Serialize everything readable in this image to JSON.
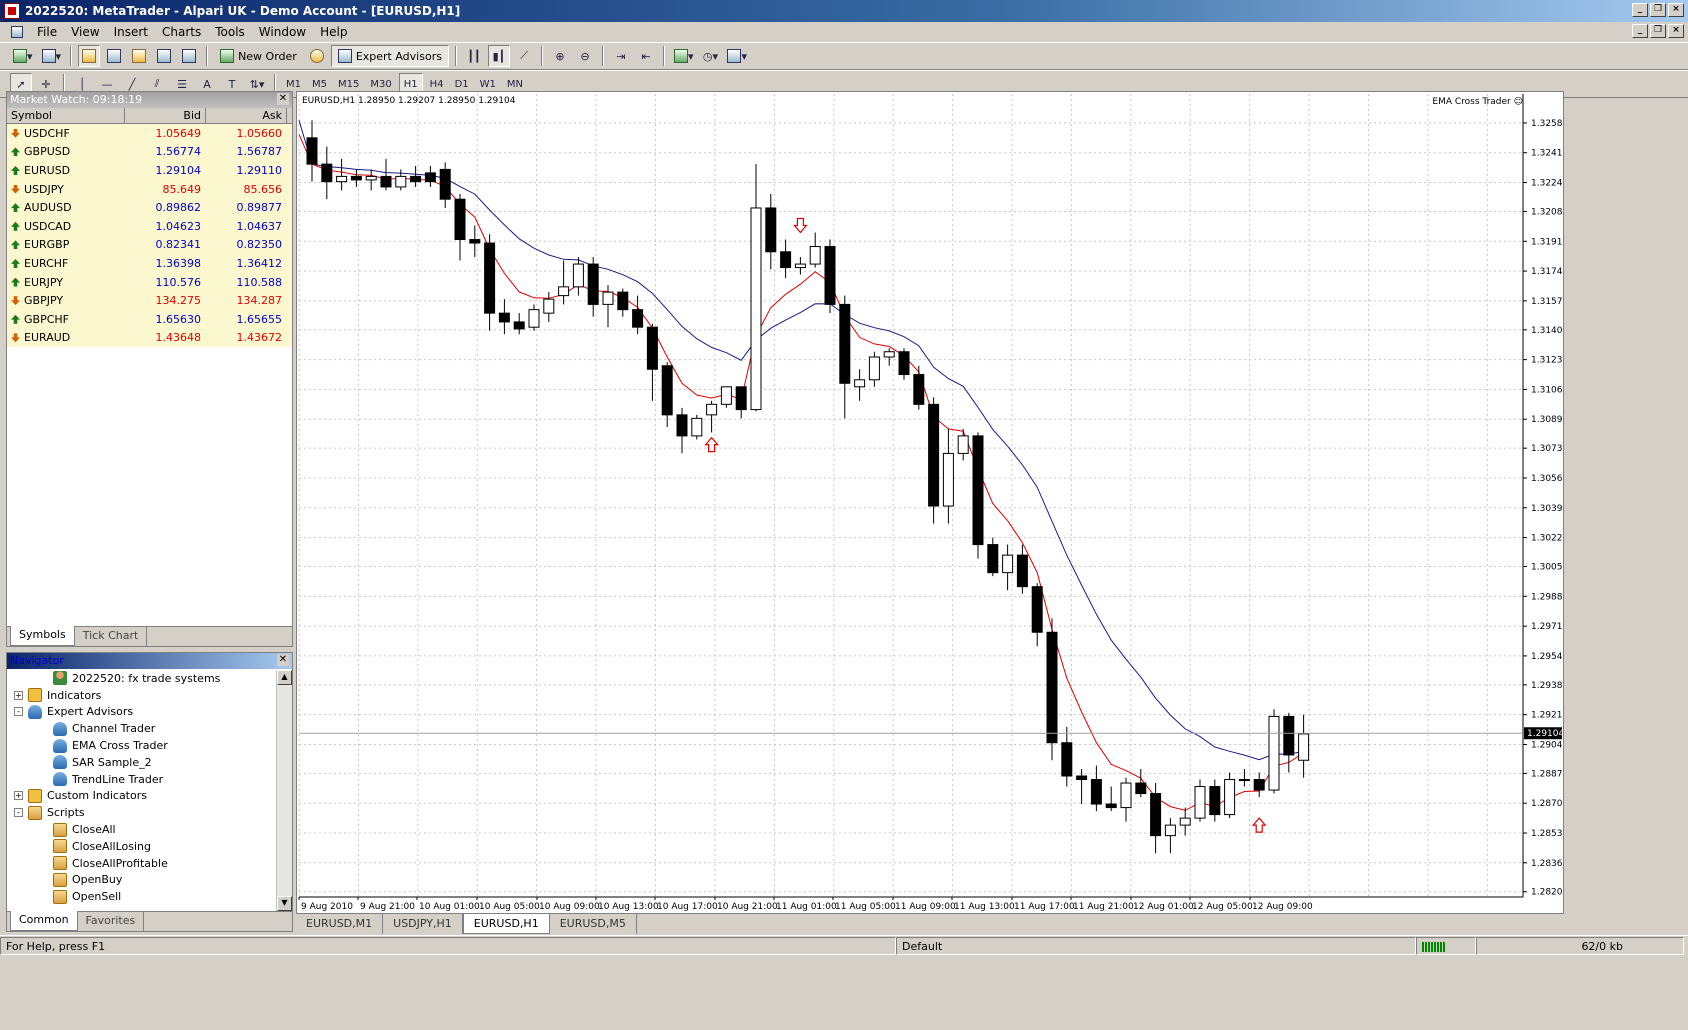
{
  "window": {
    "title": "2022520: MetaTrader - Alpari UK - Demo Account - [EURUSD,H1]"
  },
  "menu": [
    "File",
    "View",
    "Insert",
    "Charts",
    "Tools",
    "Window",
    "Help"
  ],
  "toolbar": {
    "new_order": "New Order",
    "expert_advisors": "Expert Advisors",
    "timeframes": [
      "M1",
      "M5",
      "M15",
      "M30",
      "H1",
      "H4",
      "D1",
      "W1",
      "MN"
    ],
    "active_timeframe": "H1"
  },
  "market_watch": {
    "title": "Market Watch: 09:18:19",
    "columns": [
      "Symbol",
      "Bid",
      "Ask"
    ],
    "rows": [
      {
        "symbol": "USDCHF",
        "bid": "1.05649",
        "ask": "1.05660",
        "dir": "down"
      },
      {
        "symbol": "GBPUSD",
        "bid": "1.56774",
        "ask": "1.56787",
        "dir": "up"
      },
      {
        "symbol": "EURUSD",
        "bid": "1.29104",
        "ask": "1.29110",
        "dir": "up"
      },
      {
        "symbol": "USDJPY",
        "bid": "85.649",
        "ask": "85.656",
        "dir": "down"
      },
      {
        "symbol": "AUDUSD",
        "bid": "0.89862",
        "ask": "0.89877",
        "dir": "up"
      },
      {
        "symbol": "USDCAD",
        "bid": "1.04623",
        "ask": "1.04637",
        "dir": "up"
      },
      {
        "symbol": "EURGBP",
        "bid": "0.82341",
        "ask": "0.82350",
        "dir": "up"
      },
      {
        "symbol": "EURCHF",
        "bid": "1.36398",
        "ask": "1.36412",
        "dir": "up"
      },
      {
        "symbol": "EURJPY",
        "bid": "110.576",
        "ask": "110.588",
        "dir": "up"
      },
      {
        "symbol": "GBPJPY",
        "bid": "134.275",
        "ask": "134.287",
        "dir": "down"
      },
      {
        "symbol": "GBPCHF",
        "bid": "1.65630",
        "ask": "1.65655",
        "dir": "up"
      },
      {
        "symbol": "EURAUD",
        "bid": "1.43648",
        "ask": "1.43672",
        "dir": "down"
      }
    ],
    "tabs": [
      "Symbols",
      "Tick Chart"
    ]
  },
  "navigator": {
    "title": "Navigator",
    "items": [
      {
        "label": "2022520: fx trade systems",
        "icon": "account-icon",
        "level": 2,
        "exp": ""
      },
      {
        "label": "Indicators",
        "icon": "indicators-icon",
        "level": 1,
        "exp": "+"
      },
      {
        "label": "Expert Advisors",
        "icon": "expert-icon",
        "level": 1,
        "exp": "-"
      },
      {
        "label": "Channel Trader",
        "icon": "expert-icon",
        "level": 2,
        "exp": ""
      },
      {
        "label": "EMA Cross Trader",
        "icon": "expert-icon",
        "level": 2,
        "exp": ""
      },
      {
        "label": "SAR Sample_2",
        "icon": "expert-icon",
        "level": 2,
        "exp": ""
      },
      {
        "label": "TrendLine Trader",
        "icon": "expert-icon",
        "level": 2,
        "exp": ""
      },
      {
        "label": "Custom Indicators",
        "icon": "indicators-icon",
        "level": 1,
        "exp": "+"
      },
      {
        "label": "Scripts",
        "icon": "script-icon",
        "level": 1,
        "exp": "-"
      },
      {
        "label": "CloseAll",
        "icon": "script-icon",
        "level": 2,
        "exp": ""
      },
      {
        "label": "CloseAllLosing",
        "icon": "script-icon",
        "level": 2,
        "exp": ""
      },
      {
        "label": "CloseAllProfitable",
        "icon": "script-icon",
        "level": 2,
        "exp": ""
      },
      {
        "label": "OpenBuy",
        "icon": "script-icon",
        "level": 2,
        "exp": ""
      },
      {
        "label": "OpenSell",
        "icon": "script-icon",
        "level": 2,
        "exp": ""
      }
    ],
    "tabs": [
      "Common",
      "Favorites"
    ]
  },
  "chart": {
    "info": "EURUSD,H1  1.28950 1.29207 1.28950 1.29104",
    "expert_label": "EMA Cross Trader",
    "tabs": [
      "EURUSD,M1",
      "USDJPY,H1",
      "EURUSD,H1",
      "EURUSD,M5"
    ],
    "active_tab": "EURUSD,H1"
  },
  "chart_data": {
    "type": "candlestick",
    "symbol": "EURUSD",
    "timeframe": "H1",
    "current_price": "1.29104",
    "y_ticks": [
      "1.32585",
      "1.32415",
      "1.32245",
      "1.32080",
      "1.31910",
      "1.31740",
      "1.31570",
      "1.31405",
      "1.31235",
      "1.31065",
      "1.30895",
      "1.30730",
      "1.30560",
      "1.30390",
      "1.30220",
      "1.30055",
      "1.29885",
      "1.29715",
      "1.29545",
      "1.29380",
      "1.29210",
      "1.29040",
      "1.28875",
      "1.28705",
      "1.28535",
      "1.28365",
      "1.28200"
    ],
    "x_ticks": [
      "9 Aug 2010",
      "9 Aug 21:00",
      "10 Aug 01:00",
      "10 Aug 05:00",
      "10 Aug 09:00",
      "10 Aug 13:00",
      "10 Aug 17:00",
      "10 Aug 21:00",
      "11 Aug 01:00",
      "11 Aug 05:00",
      "11 Aug 09:00",
      "11 Aug 13:00",
      "11 Aug 17:00",
      "11 Aug 21:00",
      "12 Aug 01:00",
      "12 Aug 05:00",
      "12 Aug 09:00"
    ],
    "ylim": [
      1.2817,
      1.3275
    ],
    "candles": [
      [
        1.325,
        1.326,
        1.3225,
        1.3235
      ],
      [
        1.3235,
        1.3245,
        1.3215,
        1.3225
      ],
      [
        1.3225,
        1.3238,
        1.322,
        1.3228
      ],
      [
        1.3228,
        1.3232,
        1.3222,
        1.3226
      ],
      [
        1.3226,
        1.3232,
        1.322,
        1.3228
      ],
      [
        1.3228,
        1.3238,
        1.322,
        1.3222
      ],
      [
        1.3222,
        1.3232,
        1.322,
        1.3228
      ],
      [
        1.3228,
        1.3234,
        1.3222,
        1.3225
      ],
      [
        1.323,
        1.3234,
        1.3222,
        1.3225
      ],
      [
        1.3232,
        1.3236,
        1.321,
        1.3215
      ],
      [
        1.3215,
        1.3218,
        1.318,
        1.3192
      ],
      [
        1.3192,
        1.32,
        1.3182,
        1.319
      ],
      [
        1.319,
        1.3195,
        1.314,
        1.315
      ],
      [
        1.315,
        1.3158,
        1.3138,
        1.3145
      ],
      [
        1.3145,
        1.315,
        1.3138,
        1.3141
      ],
      [
        1.3142,
        1.3155,
        1.314,
        1.3152
      ],
      [
        1.315,
        1.3162,
        1.3145,
        1.3158
      ],
      [
        1.316,
        1.318,
        1.3155,
        1.3165
      ],
      [
        1.3165,
        1.3182,
        1.316,
        1.3178
      ],
      [
        1.3178,
        1.3182,
        1.3148,
        1.3155
      ],
      [
        1.3155,
        1.3166,
        1.3142,
        1.3162
      ],
      [
        1.3162,
        1.3164,
        1.3148,
        1.3152
      ],
      [
        1.3152,
        1.316,
        1.3138,
        1.3142
      ],
      [
        1.3142,
        1.3144,
        1.31,
        1.3118
      ],
      [
        1.312,
        1.3122,
        1.3085,
        1.3092
      ],
      [
        1.3092,
        1.3096,
        1.307,
        1.308
      ],
      [
        1.308,
        1.3092,
        1.3078,
        1.309
      ],
      [
        1.3092,
        1.31,
        1.3082,
        1.3098
      ],
      [
        1.3098,
        1.3108,
        1.3096,
        1.3108
      ],
      [
        1.3108,
        1.3108,
        1.309,
        1.3095
      ],
      [
        1.3095,
        1.3235,
        1.3094,
        1.321
      ],
      [
        1.321,
        1.3218,
        1.3175,
        1.3185
      ],
      [
        1.3185,
        1.3192,
        1.317,
        1.3176
      ],
      [
        1.3176,
        1.3182,
        1.3172,
        1.3178
      ],
      [
        1.3178,
        1.3196,
        1.3176,
        1.3188
      ],
      [
        1.3188,
        1.3192,
        1.315,
        1.3155
      ],
      [
        1.3155,
        1.316,
        1.309,
        1.311
      ],
      [
        1.3108,
        1.3118,
        1.31,
        1.3112
      ],
      [
        1.3112,
        1.3128,
        1.3108,
        1.3125
      ],
      [
        1.3125,
        1.313,
        1.312,
        1.3128
      ],
      [
        1.3128,
        1.313,
        1.3112,
        1.3115
      ],
      [
        1.3115,
        1.312,
        1.3095,
        1.3098
      ],
      [
        1.3098,
        1.3102,
        1.303,
        1.304
      ],
      [
        1.304,
        1.3084,
        1.303,
        1.307
      ],
      [
        1.307,
        1.3084,
        1.3066,
        1.308
      ],
      [
        1.308,
        1.3082,
        1.301,
        1.3018
      ],
      [
        1.3018,
        1.3022,
        1.3,
        1.3002
      ],
      [
        1.3002,
        1.3018,
        1.2992,
        1.3012
      ],
      [
        1.3012,
        1.3018,
        1.299,
        1.2994
      ],
      [
        1.2994,
        1.2996,
        1.296,
        1.2968
      ],
      [
        1.2968,
        1.2976,
        1.2895,
        1.2905
      ],
      [
        1.2905,
        1.2914,
        1.288,
        1.2886
      ],
      [
        1.2886,
        1.289,
        1.287,
        1.2884
      ],
      [
        1.2884,
        1.2892,
        1.2866,
        1.287
      ],
      [
        1.287,
        1.288,
        1.2866,
        1.2868
      ],
      [
        1.2868,
        1.2885,
        1.286,
        1.2882
      ],
      [
        1.2882,
        1.289,
        1.2874,
        1.2876
      ],
      [
        1.2876,
        1.2882,
        1.2842,
        1.2852
      ],
      [
        1.2852,
        1.2862,
        1.2842,
        1.2858
      ],
      [
        1.2858,
        1.2868,
        1.2852,
        1.2862
      ],
      [
        1.2862,
        1.2884,
        1.286,
        1.288
      ],
      [
        1.288,
        1.2884,
        1.286,
        1.2864
      ],
      [
        1.2864,
        1.2888,
        1.2862,
        1.2884
      ],
      [
        1.2884,
        1.289,
        1.288,
        1.2884
      ],
      [
        1.2884,
        1.2888,
        1.2874,
        1.2878
      ],
      [
        1.2878,
        1.2924,
        1.2876,
        1.292
      ],
      [
        1.292,
        1.2922,
        1.2888,
        1.2898
      ],
      [
        1.2895,
        1.2921,
        1.2885,
        1.291
      ]
    ]
  },
  "status": {
    "help": "For Help, press F1",
    "profile": "Default",
    "traffic": "62/0 kb"
  },
  "colors": {
    "ema_fast": "#e00000",
    "ema_slow": "#1a1a8a",
    "signal": "#e00000",
    "market_watch_bg": "#fbf7cf"
  }
}
